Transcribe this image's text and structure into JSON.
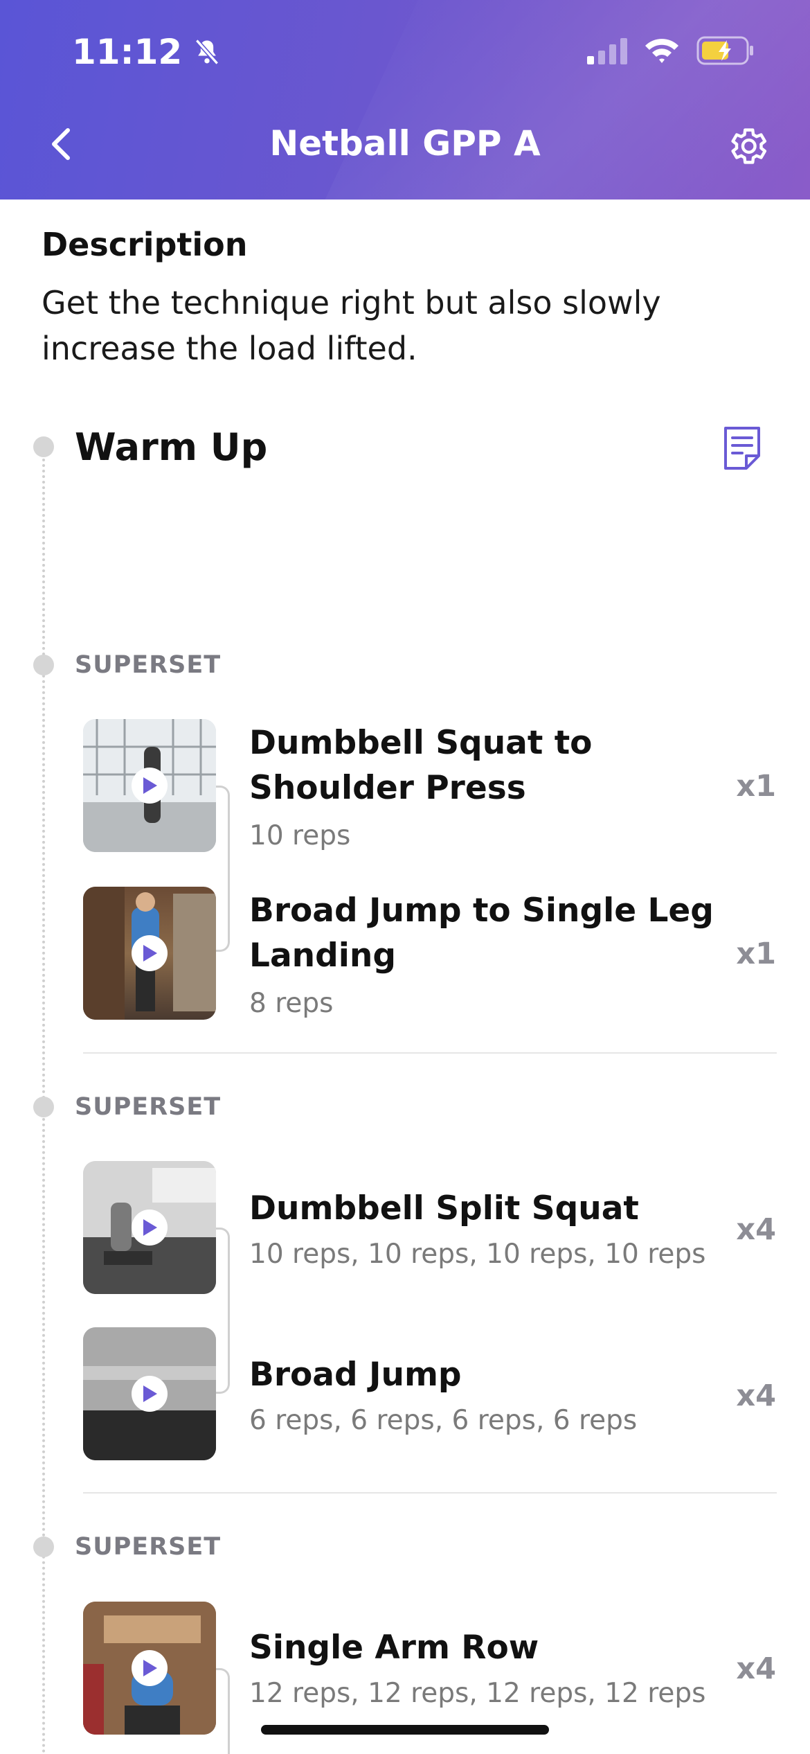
{
  "status_bar": {
    "time": "11:12"
  },
  "nav": {
    "title": "Netball GPP A"
  },
  "description": {
    "heading": "Description",
    "text": "Get the technique right but also slowly increase the load lifted."
  },
  "warm_up": {
    "title": "Warm Up"
  },
  "supersets": [
    {
      "label": "SUPERSET",
      "exercises": [
        {
          "name": "Dumbbell Squat to Shoulder Press",
          "reps": "10 reps",
          "multiplier": "x1"
        },
        {
          "name": "Broad Jump to Single Leg Landing",
          "reps": "8 reps",
          "multiplier": "x1"
        }
      ]
    },
    {
      "label": "SUPERSET",
      "exercises": [
        {
          "name": "Dumbbell Split Squat",
          "reps": "10 reps, 10 reps, 10 reps, 10 reps",
          "multiplier": "x4"
        },
        {
          "name": "Broad Jump",
          "reps": "6 reps, 6 reps, 6 reps, 6 reps",
          "multiplier": "x4"
        }
      ]
    },
    {
      "label": "SUPERSET",
      "exercises": [
        {
          "name": "Single Arm Row",
          "reps": "12 reps, 12 reps, 12 reps, 12 reps",
          "multiplier": "x4"
        }
      ]
    }
  ],
  "colors": {
    "accent": "#6a5ad5",
    "header_start": "#5a55d6",
    "header_end": "#8a5cc9"
  }
}
